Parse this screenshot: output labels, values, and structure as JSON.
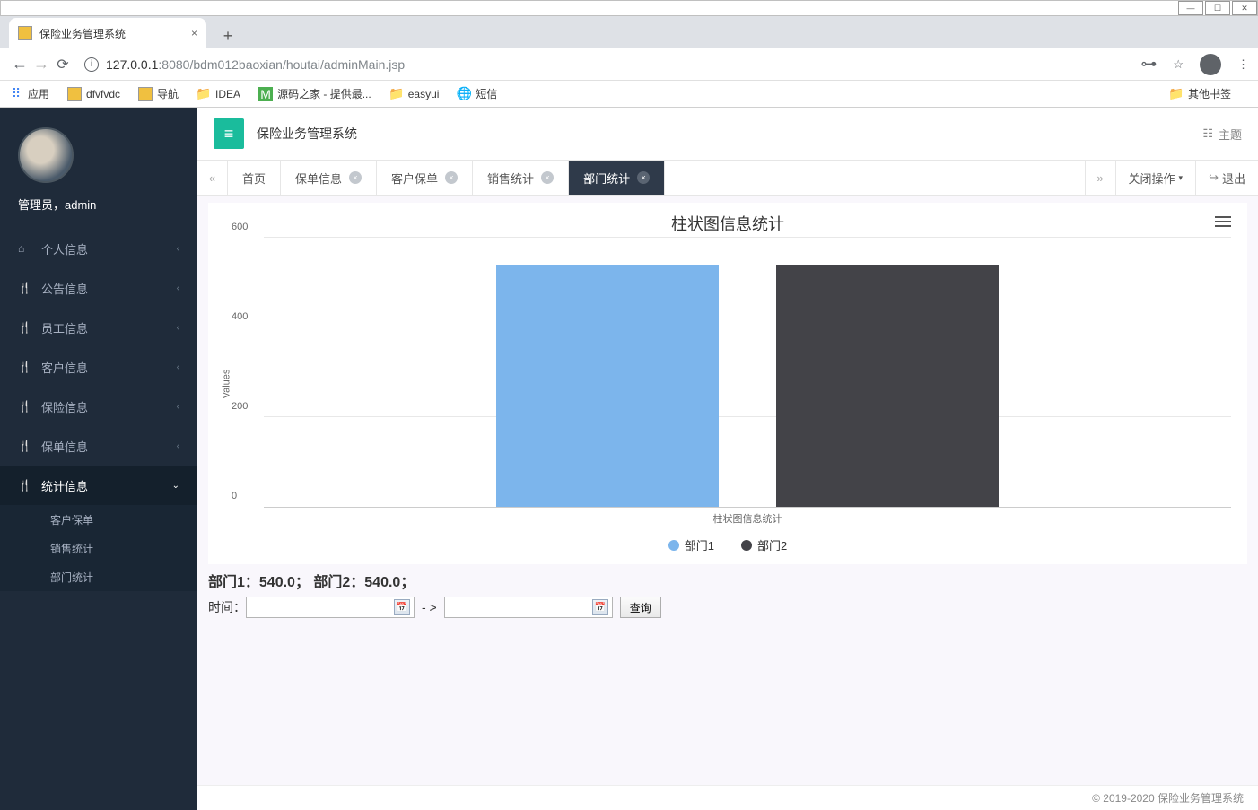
{
  "browser": {
    "tab_title": "保险业务管理系统",
    "url_host": "127.0.0.1",
    "url_port": ":8080",
    "url_path": "/bdm012baoxian/houtai/adminMain.jsp",
    "apps_label": "应用",
    "bookmarks": [
      "dfvfvdc",
      "导航",
      "IDEA",
      "源码之家 - 提供最...",
      "easyui",
      "短信"
    ],
    "other_bookmarks": "其他书签"
  },
  "header": {
    "app_title": "保险业务管理系统",
    "theme_label": "主题"
  },
  "user": {
    "display": "管理员，admin"
  },
  "sidebar": {
    "items": [
      {
        "label": "个人信息",
        "icon": "🏠"
      },
      {
        "label": "公告信息",
        "icon": "🍴"
      },
      {
        "label": "员工信息",
        "icon": "🍴"
      },
      {
        "label": "客户信息",
        "icon": "🍴"
      },
      {
        "label": "保险信息",
        "icon": "🍴"
      },
      {
        "label": "保单信息",
        "icon": "🍴"
      },
      {
        "label": "统计信息",
        "icon": "🍴"
      }
    ],
    "expanded_subs": [
      "客户保单",
      "销售统计",
      "部门统计"
    ]
  },
  "tabs": {
    "items": [
      {
        "label": "首页",
        "closable": false
      },
      {
        "label": "保单信息",
        "closable": true
      },
      {
        "label": "客户保单",
        "closable": true
      },
      {
        "label": "销售统计",
        "closable": true
      },
      {
        "label": "部门统计",
        "closable": true,
        "active": true
      }
    ],
    "close_ops": "关闭操作",
    "logout": "退出"
  },
  "summary_text": "部门1：540.0； 部门2：540.0；",
  "filter": {
    "time_label": "时间：",
    "arrow": "- >",
    "query": "查询"
  },
  "footer": "© 2019-2020 保险业务管理系统",
  "chart_data": {
    "type": "bar",
    "title": "柱状图信息统计",
    "x_category_label": "柱状图信息统计",
    "ylabel": "Values",
    "ylim": [
      0,
      600
    ],
    "y_ticks": [
      0,
      200,
      400,
      600
    ],
    "series": [
      {
        "name": "部门1",
        "value": 540.0,
        "color": "#7cb5ec"
      },
      {
        "name": "部门2",
        "value": 540.0,
        "color": "#434348"
      }
    ]
  }
}
